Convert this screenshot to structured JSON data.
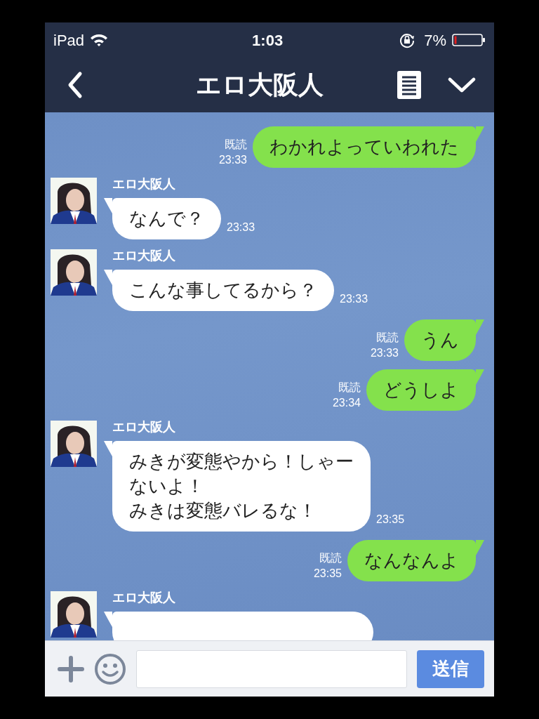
{
  "status_bar": {
    "carrier": "iPad",
    "time": "1:03",
    "battery": "7%"
  },
  "header": {
    "title": "エロ大阪人"
  },
  "messages": [
    {
      "kind": "sent",
      "text": "わかれよっていわれた",
      "read": "既読",
      "time": "23:33"
    },
    {
      "kind": "received",
      "sender": "エロ大阪人",
      "text": "なんで？",
      "time": "23:33"
    },
    {
      "kind": "received",
      "sender": "エロ大阪人",
      "text": "こんな事してるから？",
      "time": "23:33"
    },
    {
      "kind": "sent",
      "text": "うん",
      "read": "既読",
      "time": "23:33"
    },
    {
      "kind": "sent",
      "text": "どうしよ",
      "read": "既読",
      "time": "23:34"
    },
    {
      "kind": "received",
      "sender": "エロ大阪人",
      "lines": [
        "みきが変態やから！しゃー",
        "ないよ！",
        "みきは変態バレるな！"
      ],
      "time": "23:35"
    },
    {
      "kind": "sent",
      "text": "なんなんよ",
      "read": "既読",
      "time": "23:35"
    },
    {
      "kind": "received",
      "sender": "エロ大阪人"
    }
  ],
  "composer": {
    "send_button": "送信"
  }
}
